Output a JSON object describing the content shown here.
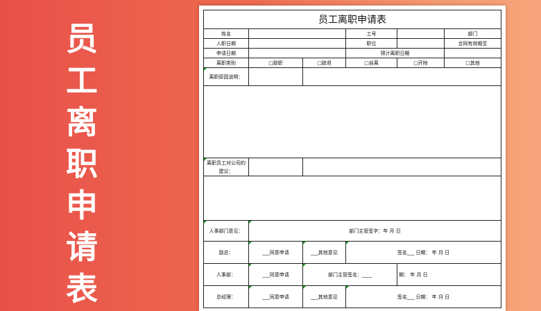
{
  "side_title": [
    "员",
    "工",
    "离",
    "职",
    "申",
    "请",
    "表"
  ],
  "form": {
    "title": "员工离职申请表",
    "row1": {
      "name": "姓名",
      "id": "工号",
      "dept": "部门"
    },
    "row2": {
      "join_date": "入职日期",
      "position": "职位",
      "contract": "合同有效期至"
    },
    "row3": {
      "apply_date": "申请日期",
      "expected": "预计离职日期"
    },
    "row4": {
      "type": "离职类别",
      "opts": [
        "□辞职",
        "□辞退",
        "□自离",
        "□开除",
        "□其他"
      ]
    },
    "reason": "离职原因说明：",
    "suggest": "离职员工对公司的建议：",
    "hr_dept_opinion": "人事部门意见：",
    "dept_sign": "部门主管签字：年 月 日",
    "vp": {
      "label": "副总：",
      "agree": "___同意申请",
      "other": "___其他意见",
      "sign": "签名___ 日期：  年   月   日"
    },
    "hr": {
      "label": "人事部：",
      "agree": "___同意申请",
      "mgr_sign": "部门主管签名：____",
      "date": "期：  年   月   日"
    },
    "gm": {
      "label": "总经理：",
      "agree": "___同意申请",
      "other": "___其他意见",
      "sign": "签名___ 日期：  年   月   日"
    }
  }
}
